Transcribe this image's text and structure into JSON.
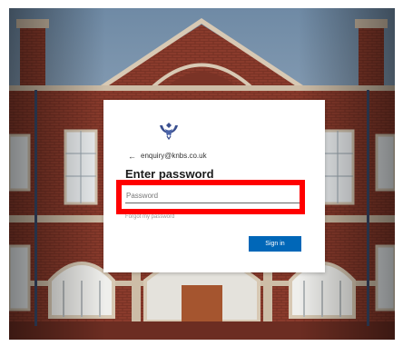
{
  "account": {
    "email": "enquiry@knbs.co.uk"
  },
  "signin": {
    "title": "Enter password",
    "password_placeholder": "Password",
    "forgot_label": "Forgot my password",
    "submit_label": "Sign in"
  },
  "icons": {
    "back": "back-arrow-icon",
    "logo": "school-crest-icon"
  },
  "colors": {
    "primary_button": "#0067b8",
    "highlight": "#ff0000",
    "brick": "#8a3b2c"
  }
}
